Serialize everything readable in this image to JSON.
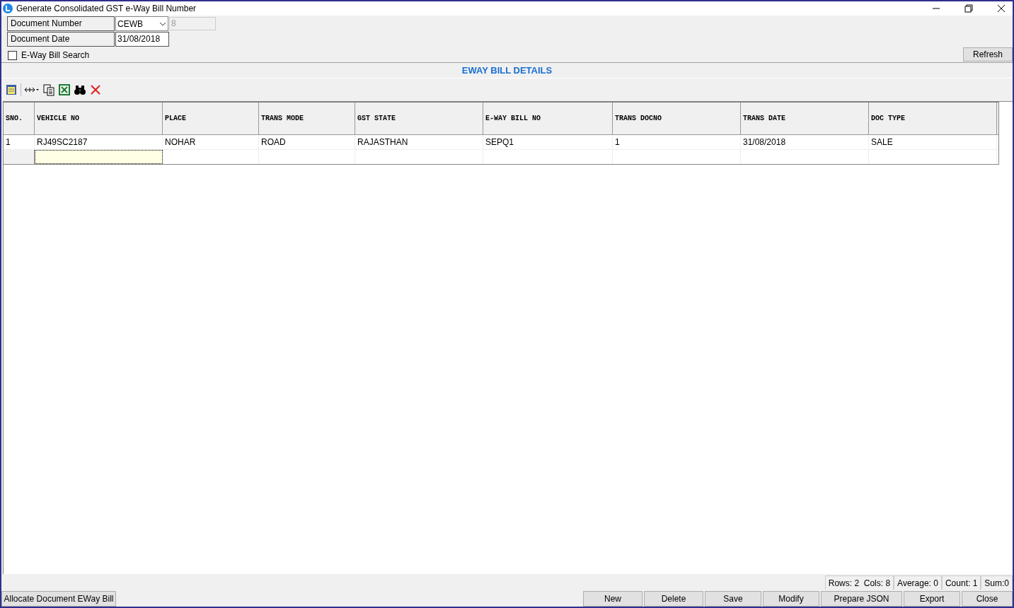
{
  "window": {
    "title": "Generate Consolidated GST e-Way Bill Number"
  },
  "form": {
    "document_number": {
      "label": "Document Number",
      "series": "CEWB",
      "number": "8"
    },
    "document_date": {
      "label": "Document Date",
      "value": "31/08/2018"
    },
    "eway_search": {
      "label": "E-Way Bill Search",
      "checked": false
    },
    "refresh": "Refresh"
  },
  "section_title": "EWAY BILL DETAILS",
  "table": {
    "columns": [
      "SNO.",
      "VEHICLE NO",
      "PLACE",
      "TRANS MODE",
      "GST STATE",
      "E-WAY BILL NO",
      "TRANS DOCNO",
      "TRANS DATE",
      "DOC TYPE"
    ],
    "rows": [
      [
        "1",
        "RJ49SC2187",
        "NOHAR",
        "ROAD",
        "RAJASTHAN",
        "SEPQ1",
        "1",
        "31/08/2018",
        "SALE"
      ]
    ],
    "new_row": {
      "selected": true
    }
  },
  "status_bar": [
    "Rows: 2  Cols: 8",
    "Average: 0",
    "Count: 1",
    "Sum:0"
  ],
  "left_button": "Allocate Document EWay Bill",
  "buttons": [
    "New",
    "Delete",
    "Save",
    "Modify",
    "Prepare JSON",
    "Export",
    "Close"
  ]
}
